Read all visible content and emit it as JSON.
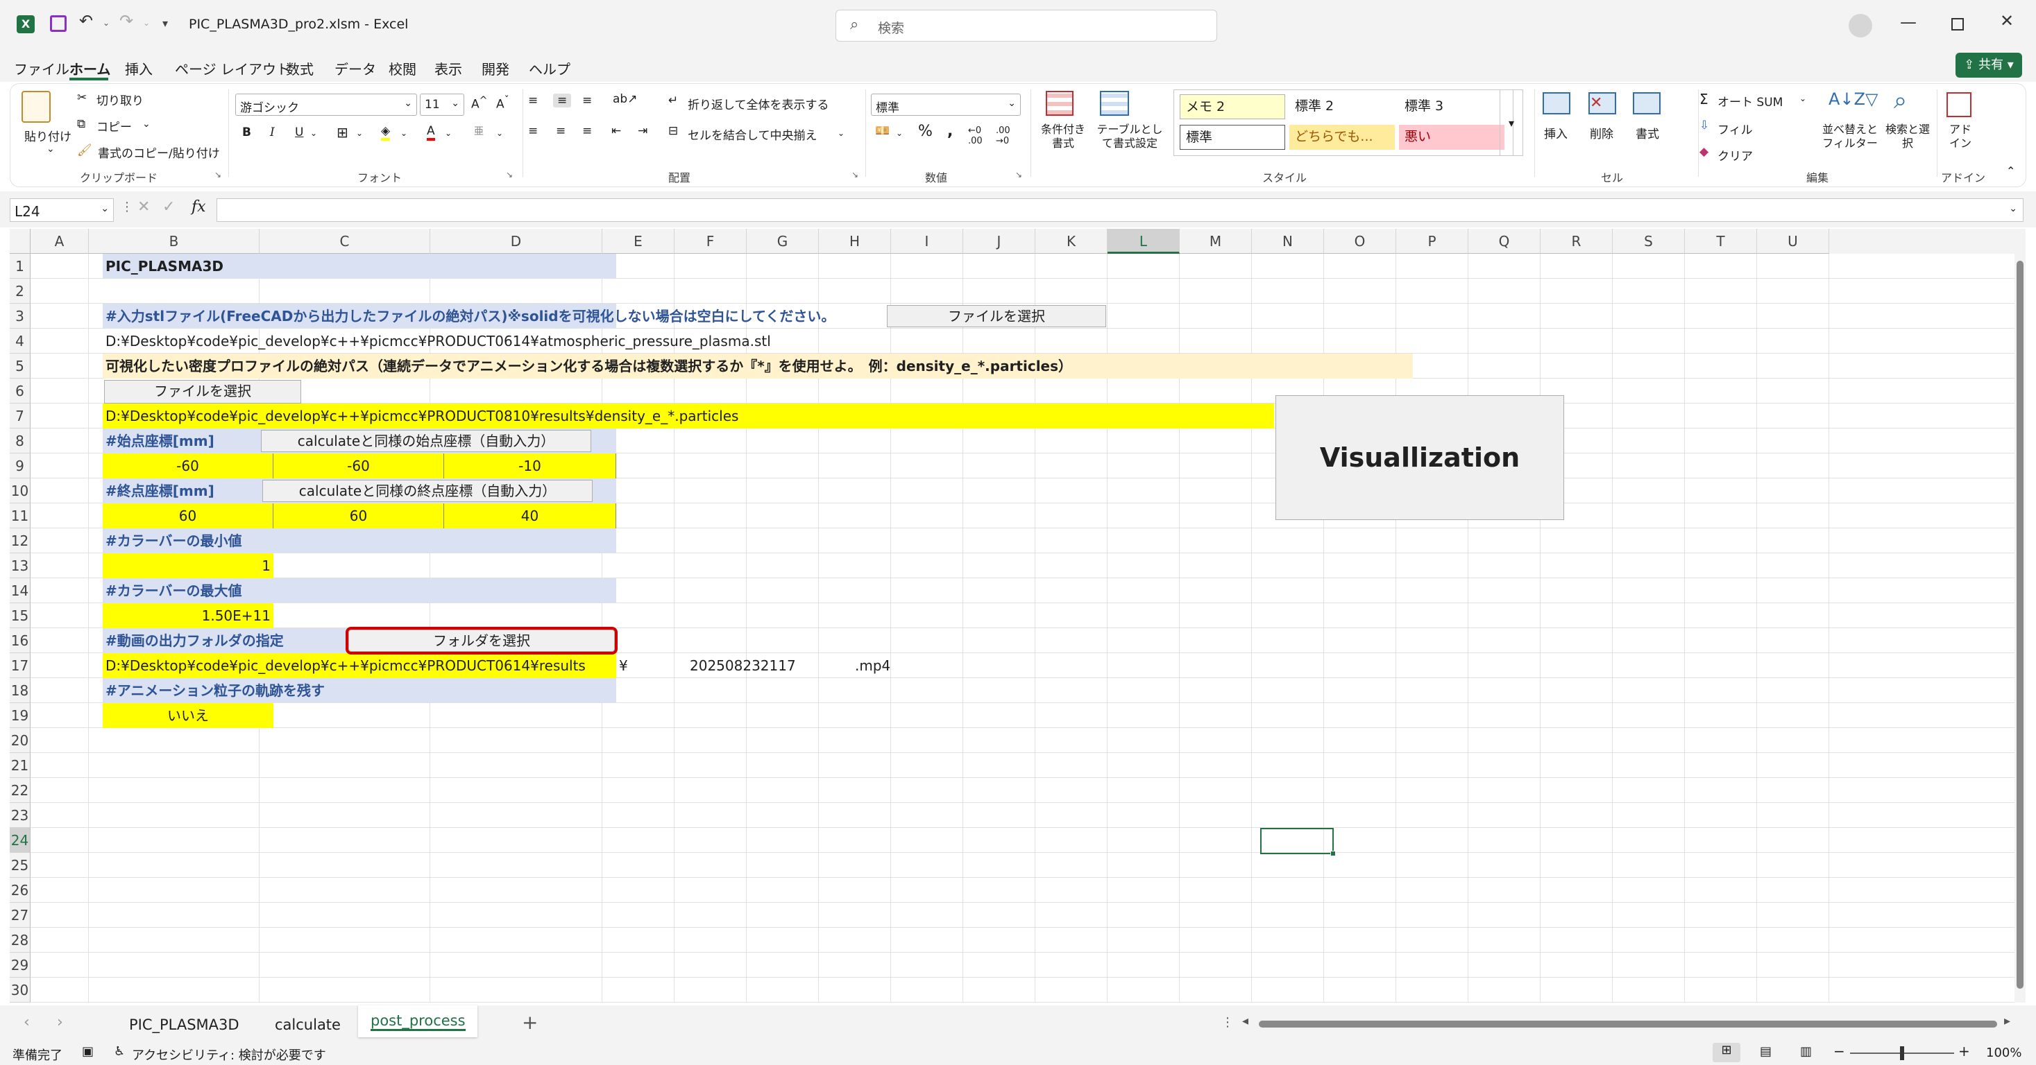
{
  "window": {
    "file_title": "PIC_PLASMA3D_pro2.xlsm",
    "sep": "-",
    "app": "Excel",
    "search_placeholder": "検索",
    "share": "共有"
  },
  "ribbon_tabs": [
    "ファイル",
    "ホーム",
    "挿入",
    "ページ レイアウト",
    "数式",
    "データ",
    "校閲",
    "表示",
    "開発",
    "ヘルプ"
  ],
  "ribbon": {
    "paste": "貼り付け",
    "cut": "切り取り",
    "copy": "コピー",
    "format_painter": "書式のコピー/貼り付け",
    "clipboard": "クリップボード",
    "font_name": "游ゴシック",
    "font_size": "11",
    "font": "フォント",
    "wrap_text": "折り返して全体を表示する",
    "merge_center": "セルを結合して中央揃え",
    "alignment": "配置",
    "number_format": "標準",
    "number": "数値",
    "cond_format": "条件付き書式",
    "table_format": "テーブルとして書式設定",
    "style_memo2": "メモ 2",
    "style_std2": "標準 2",
    "style_std3": "標準 3",
    "style_std": "標準",
    "style_neutral": "どちらでも...",
    "style_bad": "悪い",
    "styles": "スタイル",
    "insert": "挿入",
    "delete": "削除",
    "format": "書式",
    "cells": "セル",
    "autosum": "オート SUM",
    "fill": "フィル",
    "clear": "クリア",
    "sort_filter": "並べ替えとフィルター",
    "find_select": "検索と選択",
    "editing": "編集",
    "addin": "アドイン",
    "addin_group": "アドイン"
  },
  "namebox": "L24",
  "fx": "fx",
  "columns": [
    "A",
    "B",
    "C",
    "D",
    "E",
    "F",
    "G",
    "H",
    "I",
    "J",
    "K",
    "L",
    "M",
    "N",
    "O",
    "P",
    "Q",
    "R",
    "S",
    "T",
    "U"
  ],
  "rows": [
    "1",
    "2",
    "3",
    "4",
    "5",
    "6",
    "7",
    "8",
    "9",
    "10",
    "11",
    "12",
    "13",
    "14",
    "15",
    "16",
    "17",
    "18",
    "19",
    "20",
    "21",
    "22",
    "23",
    "24",
    "25",
    "26",
    "27",
    "28",
    "29",
    "30"
  ],
  "cells": {
    "b1": "PIC_PLASMA3D",
    "b3": "#入力stlファイル(FreeCADから出力したファイルの絶対パス)※solidを可視化しない場合は空白にしてください。",
    "b4": "D:¥Desktop¥code¥pic_develop¥c++¥picmcc¥PRODUCT0614¥atmospheric_pressure_plasma.stl",
    "b5": "可視化したい密度プロファイルの絶対パス（連続データでアニメーション化する場合は複数選択するか『*』を使用せよ。　例：density_e_*.particles）",
    "b7": "D:¥Desktop¥code¥pic_develop¥c++¥picmcc¥PRODUCT0810¥results¥density_e_*.particles",
    "b8": "#始点座標[mm]",
    "b9": "-60",
    "c9": "-60",
    "d9": "-10",
    "b10": "#終点座標[mm]",
    "b11": "60",
    "c11": "60",
    "d11": "40",
    "b12": "#カラーバーの最小値",
    "b13": "1",
    "b14": "#カラーバーの最大値",
    "b15": "1.50E+11",
    "b16": "#動画の出力フォルダの指定",
    "b17": "D:¥Desktop¥code¥pic_develop¥c++¥picmcc¥PRODUCT0614¥results",
    "e17": "¥",
    "f17": "202508232117",
    "g17": ".mp4",
    "b18": "#アニメーション粒子の軌跡を残す",
    "b19": "いいえ"
  },
  "buttons": {
    "select_file_1": "ファイルを選択",
    "select_file_2": "ファイルを選択",
    "start_auto": "calculateと同様の始点座標（自動入力）",
    "end_auto": "calculateと同様の終点座標（自動入力）",
    "select_folder": "フォルダを選択",
    "visualize": "Visuallization"
  },
  "sheet_tabs": [
    "PIC_PLASMA3D",
    "calculate",
    "post_process"
  ],
  "status": {
    "ready": "準備完了",
    "accessibility": "アクセシビリティ: 検討が必要です",
    "zoom": "100%"
  },
  "colors": {
    "excel_green": "#217346",
    "header_blue": "#d9e1f2",
    "yellow": "#ffff00",
    "cream": "#fff2cc",
    "red_outline": "#d00000"
  }
}
